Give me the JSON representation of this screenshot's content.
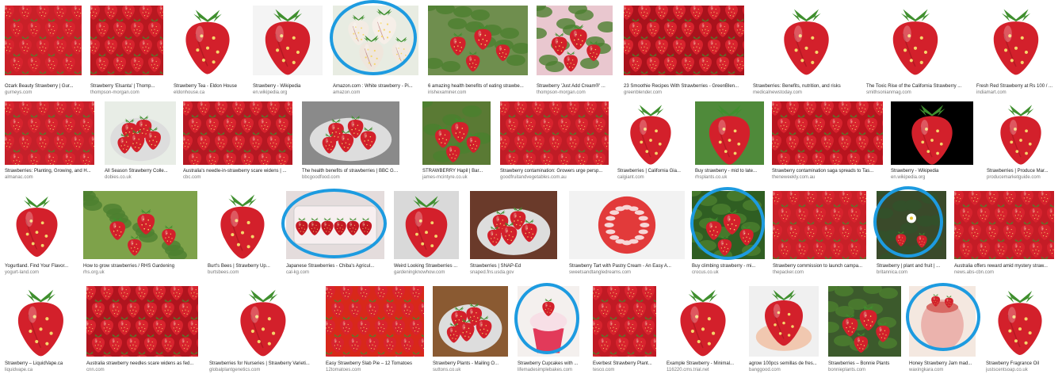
{
  "colors": {
    "highlight_ring": "#1d9be0",
    "caption_text": "#222222",
    "source_text": "#777777"
  },
  "rows": [
    {
      "tiles": [
        {
          "caption": "Ozark Beauty Strawberry | Gur...",
          "source": "gurneys.com",
          "icon": "strawberry-pile",
          "bg": "#c92028",
          "highlighted": false
        },
        {
          "caption": "Strawberry 'Elsanta' | Thomp...",
          "source": "thompson-morgan.com",
          "icon": "strawberry-pile",
          "bg": "#b81820",
          "highlighted": false
        },
        {
          "caption": "Strawberry Tea - Eldon House",
          "source": "eldonhouse.ca",
          "icon": "single-strawberry",
          "bg": "#ffffff",
          "highlighted": false
        },
        {
          "caption": "Strawberry - Wikipedia",
          "source": "en.wikipedia.org",
          "icon": "single-strawberry",
          "bg": "#f4f4f4",
          "highlighted": false
        },
        {
          "caption": "Amazon.com : White strawberry - Pi...",
          "source": "amazon.com",
          "icon": "white-strawberries",
          "bg": "#e8ece2",
          "highlighted": true
        },
        {
          "caption": "6 amazing health benefits of eating strawbe...",
          "source": "irishexaminer.com",
          "icon": "strawberry-plant",
          "bg": "#6f8e4e",
          "highlighted": false
        },
        {
          "caption": "Strawberry 'Just Add Cream®' ...",
          "source": "thompson-morgan.com",
          "icon": "strawberry-plant",
          "bg": "#e9c7cf",
          "highlighted": false
        },
        {
          "caption": "23 Smoothie Recipes With Strawberries - GreenBlen...",
          "source": "greenblender.com",
          "icon": "strawberry-pile",
          "bg": "#a9121c",
          "highlighted": false
        },
        {
          "caption": "Strawberries: Benefits, nutrition, and risks",
          "source": "medicalnewstoday.com",
          "icon": "single-strawberry",
          "bg": "#ffffff",
          "highlighted": false
        },
        {
          "caption": "The Toxic Rise of the California Strawberry ...",
          "source": "smithsonianmag.com",
          "icon": "single-strawberry",
          "bg": "#ffffff",
          "highlighted": false
        },
        {
          "caption": "Fresh Red Strawberry at Rs 100 / ...",
          "source": "indiamart.com",
          "icon": "single-strawberry",
          "bg": "#ffffff",
          "highlighted": false
        }
      ]
    },
    {
      "tiles": [
        {
          "caption": "Strawberries: Planting, Growing, and H...",
          "source": "almanac.com",
          "icon": "strawberry-pile",
          "bg": "#c5202a",
          "highlighted": false
        },
        {
          "caption": "All Season Strawberry Colle...",
          "source": "dobies.co.uk",
          "icon": "strawberry-bowl",
          "bg": "#e8ede6",
          "highlighted": false
        },
        {
          "caption": "Australia's needle-in-strawberry scare widens | ...",
          "source": "cbc.com",
          "icon": "strawberry-pile",
          "bg": "#b51822",
          "highlighted": false
        },
        {
          "caption": "The health benefits of strawberries | BBC Good ...",
          "source": "bbcgoodfood.com",
          "icon": "strawberry-bowl",
          "bg": "#8a8a8a",
          "highlighted": false
        },
        {
          "caption": "STRAWBERRY Hapil | Bar...",
          "source": "james-mcintyre.co.uk",
          "icon": "strawberry-plant",
          "bg": "#5a7a34",
          "highlighted": false
        },
        {
          "caption": "Strawberry contamination: Growers urge persp...",
          "source": "goodfruitandvegetables.com.au",
          "icon": "strawberry-pile",
          "bg": "#c01c26",
          "highlighted": false
        },
        {
          "caption": "Strawberries | California Gia...",
          "source": "calgiant.com",
          "icon": "single-strawberry",
          "bg": "#ffffff",
          "highlighted": false
        },
        {
          "caption": "Buy strawberry - mid to late...",
          "source": "rhsplants.co.uk",
          "icon": "single-strawberry",
          "bg": "#4f8a3a",
          "highlighted": false
        },
        {
          "caption": "Strawberry contamination saga spreads to Tas...",
          "source": "theneweekly.com.au",
          "icon": "strawberry-pile",
          "bg": "#b8141e",
          "highlighted": false
        },
        {
          "caption": "Strawberry - Wikipedia",
          "source": "en.wikipedia.org",
          "icon": "single-strawberry",
          "bg": "#000000",
          "highlighted": false
        },
        {
          "caption": "Strawberries | Produce Mar...",
          "source": "producemarketguide.com",
          "icon": "single-strawberry",
          "bg": "#ffffff",
          "highlighted": false
        }
      ]
    },
    {
      "tiles": [
        {
          "caption": "Yogurtland. Find Your Flavor...",
          "source": "yogurt-land.com",
          "icon": "single-strawberry",
          "bg": "#ffffff",
          "highlighted": false
        },
        {
          "caption": "How to grow strawberries / RHS Gardening",
          "source": "rhs.org.uk",
          "icon": "strawberry-plant",
          "bg": "#7ea24a",
          "highlighted": false
        },
        {
          "caption": "Burt's Bees | Strawberry Up...",
          "source": "burtsbees.com",
          "icon": "single-strawberry",
          "bg": "#ffffff",
          "highlighted": false
        },
        {
          "caption": "Japanese Strawberries - Chiba's Agricul...",
          "source": "cal-kg.com",
          "icon": "strawberry-box",
          "bg": "#e4dcdc",
          "highlighted": true
        },
        {
          "caption": "Weird Looking Strawberries ...",
          "source": "gardeningknowhow.com",
          "icon": "single-strawberry",
          "bg": "#d9d9d9",
          "highlighted": false
        },
        {
          "caption": "Strawberries | SNAP-Ed",
          "source": "snaped.fns.usda.gov",
          "icon": "strawberry-bowl",
          "bg": "#6a3a2a",
          "highlighted": false
        },
        {
          "caption": "Strawberry Tart with Pastry Cream - An Easy A...",
          "source": "sweetsandtangledreams.com",
          "icon": "strawberry-tart",
          "bg": "#f2f2f2",
          "highlighted": false
        },
        {
          "caption": "Buy climbing strawberry - mi...",
          "source": "crocus.co.uk",
          "icon": "strawberry-plant",
          "bg": "#2f5e22",
          "highlighted": true
        },
        {
          "caption": "Strawberry commission to launch campa...",
          "source": "thepacker.com",
          "icon": "strawberry-pile",
          "bg": "#c82028",
          "highlighted": false
        },
        {
          "caption": "Strawberry | plant and fruit | ...",
          "source": "britannica.com",
          "icon": "strawberry-flower",
          "bg": "#3a4a2a",
          "highlighted": true
        },
        {
          "caption": "Australia offers reward amid mystery straw...",
          "source": "news.abs-cbn.com",
          "icon": "strawberry-pile",
          "bg": "#c41c26",
          "highlighted": false
        }
      ]
    },
    {
      "tiles": [
        {
          "caption": "Strawberry – LiquidVape.ca",
          "source": "liquidvape.ca",
          "icon": "single-strawberry",
          "bg": "#ffffff",
          "highlighted": false
        },
        {
          "caption": "Australia strawberry needles scare widens as fed...",
          "source": "cnn.com",
          "icon": "strawberry-pile",
          "bg": "#b0141e",
          "highlighted": false
        },
        {
          "caption": "Strawberries for Nurseries | Strawberry Varieti...",
          "source": "globalplantgenetics.com",
          "icon": "single-strawberry",
          "bg": "#ffffff",
          "highlighted": false
        },
        {
          "caption": "Easy Strawberry Slab Pie – 12 Tomatoes",
          "source": "12tomatoes.com",
          "icon": "strawberry-pile",
          "bg": "#d8281a",
          "highlighted": false
        },
        {
          "caption": "Strawberry Plants - Mailing O...",
          "source": "suttons.co.uk",
          "icon": "strawberry-bowl",
          "bg": "#8a5a32",
          "highlighted": false
        },
        {
          "caption": "Strawberry Cupcakes with ...",
          "source": "lifemadesimplebakes.com",
          "icon": "strawberry-cupcake",
          "bg": "#f4f0ee",
          "highlighted": true
        },
        {
          "caption": "Everbest Strawberry Plant...",
          "source": "tesco.com",
          "icon": "strawberry-pile",
          "bg": "#c01a24",
          "highlighted": false
        },
        {
          "caption": "Example Strawberry - Minimal...",
          "source": "116220.cms.trial.net",
          "icon": "single-strawberry",
          "bg": "#ffffff",
          "highlighted": false
        },
        {
          "caption": "agrow 100pcs semillas de fres...",
          "source": "banggood.com",
          "icon": "strawberry-hand",
          "bg": "#f0f0f0",
          "highlighted": false
        },
        {
          "caption": "Strawberries – Bonnie Plants",
          "source": "bonnieplants.com",
          "icon": "strawberry-plant",
          "bg": "#3c5a2c",
          "highlighted": false
        },
        {
          "caption": "Honey Strawberry Jam mad...",
          "source": "waxingkara.com",
          "icon": "strawberry-jar",
          "bg": "#f4e8e0",
          "highlighted": true
        },
        {
          "caption": "Strawberry Fragrance Oil",
          "source": "justscentsoap.co.uk",
          "icon": "single-strawberry",
          "bg": "#ffffff",
          "highlighted": false
        }
      ]
    }
  ]
}
